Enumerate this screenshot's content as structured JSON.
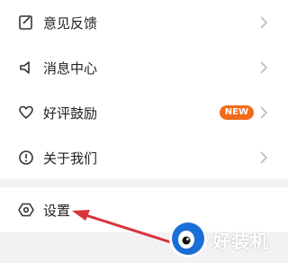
{
  "menu": {
    "items": [
      {
        "label": "意见反馈",
        "icon": "feedback-icon"
      },
      {
        "label": "消息中心",
        "icon": "speaker-icon"
      },
      {
        "label": "好评鼓励",
        "icon": "heart-icon",
        "badge": "NEW"
      },
      {
        "label": "关于我们",
        "icon": "info-icon"
      }
    ]
  },
  "settings": {
    "label": "设置",
    "icon": "settings-hexagon-icon"
  },
  "colors": {
    "badge": "#f26a1b",
    "arrow": "#d9333a",
    "logo": "#1a6fd6"
  },
  "watermark": {
    "text": "好装机"
  }
}
